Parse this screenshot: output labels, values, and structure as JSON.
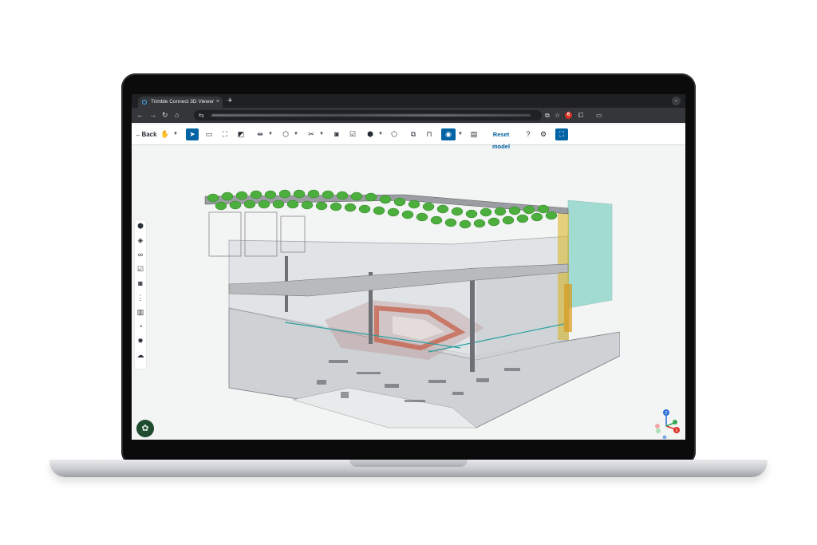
{
  "browser": {
    "tab_title": "Trimble Connect 3D Viewer",
    "tab_close": "×",
    "new_tab": "+",
    "window_menu": "⌄",
    "extension_badge": "6"
  },
  "toolbar": {
    "back_label": "Back",
    "reset_label": "Reset model"
  },
  "colors": {
    "accent": "#0063a3",
    "screen_bg": "#f3f4f4",
    "fab_bg": "#1e4a2e",
    "trees": "#4caf3d",
    "stair_yellow": "#d7b21c",
    "glass_cyan": "#5fc7b6"
  },
  "icons": {
    "toolbar": [
      "back-arrow-icon",
      "hand-pan-icon",
      "select-pointer-icon",
      "area-select-icon",
      "bounding-box-icon",
      "section-box-icon",
      "measure-icon",
      "shape-icon",
      "scissors-clip-icon",
      "snapshot-icon",
      "checklist-icon",
      "cube-icon",
      "shape-3d-icon",
      "layers-icon",
      "lock-icon",
      "eye-visibility-icon",
      "calculator-icon",
      "help-icon",
      "settings-icon",
      "fullscreen-icon"
    ],
    "side_panel": [
      "objects-cube-icon",
      "layers-icon",
      "link-icon",
      "todo-check-icon",
      "camera-icon",
      "tree-structure-icon",
      "table-icon",
      "tag-icon",
      "gear-effect-icon",
      "cloud-icon"
    ],
    "fab": "palette-icon"
  },
  "gizmo": {
    "z": "Z",
    "x": "X"
  }
}
